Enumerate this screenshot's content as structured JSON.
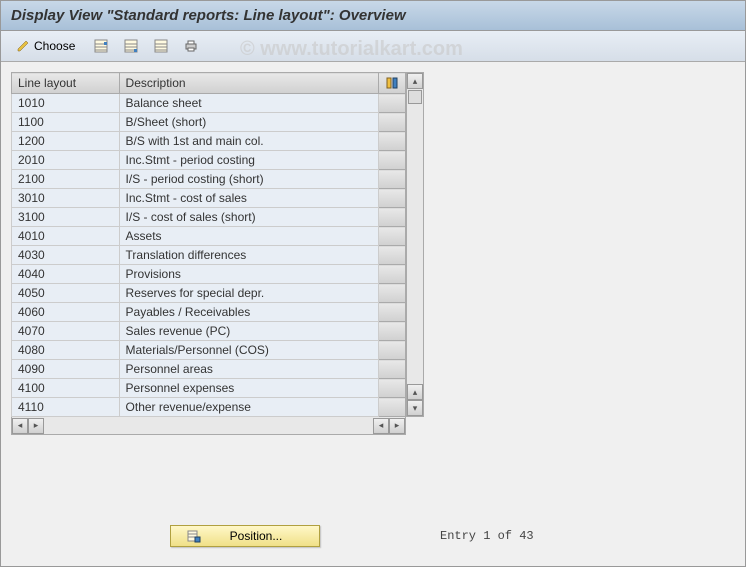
{
  "header": {
    "title": "Display View \"Standard reports: Line layout\": Overview"
  },
  "toolbar": {
    "choose_label": "Choose"
  },
  "watermark": "© www.tutorialkart.com",
  "table": {
    "columns": {
      "layout": "Line layout",
      "description": "Description"
    },
    "rows": [
      {
        "layout": "1010",
        "description": "Balance sheet"
      },
      {
        "layout": "1100",
        "description": "B/Sheet (short)"
      },
      {
        "layout": "1200",
        "description": "B/S with 1st and main col."
      },
      {
        "layout": "2010",
        "description": "Inc.Stmt - period costing"
      },
      {
        "layout": "2100",
        "description": "I/S - period costing (short)"
      },
      {
        "layout": "3010",
        "description": "Inc.Stmt - cost of sales"
      },
      {
        "layout": "3100",
        "description": "I/S - cost of sales (short)"
      },
      {
        "layout": "4010",
        "description": "Assets"
      },
      {
        "layout": "4030",
        "description": "Translation differences"
      },
      {
        "layout": "4040",
        "description": "Provisions"
      },
      {
        "layout": "4050",
        "description": "Reserves for special depr."
      },
      {
        "layout": "4060",
        "description": "Payables / Receivables"
      },
      {
        "layout": "4070",
        "description": "Sales revenue (PC)"
      },
      {
        "layout": "4080",
        "description": "Materials/Personnel (COS)"
      },
      {
        "layout": "4090",
        "description": "Personnel areas"
      },
      {
        "layout": "4100",
        "description": "Personnel expenses"
      },
      {
        "layout": "4110",
        "description": "Other revenue/expense"
      }
    ]
  },
  "footer": {
    "position_label": "Position...",
    "entry_label": "Entry 1 of 43"
  }
}
